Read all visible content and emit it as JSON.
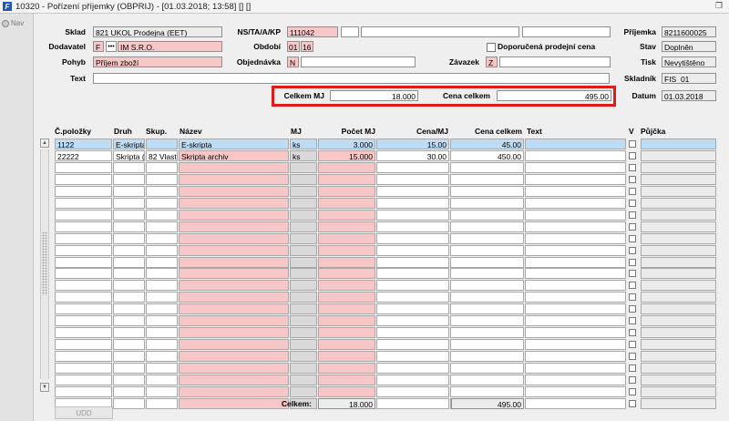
{
  "window": {
    "title": "10320 - Pořízení příjemky (OBPRIJ) - [01.03.2018; 13:58] [] []",
    "logo_text": "F"
  },
  "nav": {
    "label": "Nav"
  },
  "header": {
    "sklad": {
      "label": "Sklad",
      "value": "821 UKOL Prodejna (EET)"
    },
    "dodavatel": {
      "label": "Dodavatel",
      "code": "F",
      "dots": "•••",
      "name": "IM S.R.O."
    },
    "pohyb": {
      "label": "Pohyb",
      "value": "Příjem zboží"
    },
    "text": {
      "label": "Text",
      "value": ""
    },
    "nstaakp": {
      "label": "NS/TA/A/KP",
      "value": "111042",
      "v2": "",
      "v3": "",
      "v4": ""
    },
    "obdobi": {
      "label": "Období",
      "month": "01",
      "year": "16"
    },
    "objednavka": {
      "label": "Objednávka",
      "code": "N",
      "value": ""
    },
    "doporucena": {
      "label": "Doporučená prodejní cena",
      "checked": false
    },
    "zavazek": {
      "label": "Závazek",
      "code": "Z",
      "value": ""
    },
    "prijemka": {
      "label": "Příjemka",
      "value": "8211600025"
    },
    "stav": {
      "label": "Stav",
      "value": "Doplněn"
    },
    "tisk": {
      "label": "Tisk",
      "value": "Nevytištěno"
    },
    "skladnik": {
      "label": "Skladník",
      "value": "FIS_01"
    },
    "datum": {
      "label": "Datum",
      "value": "01.03.2018"
    },
    "celkem_mj": {
      "label": "Celkem MJ",
      "value": "18.000"
    },
    "cena_celkem": {
      "label": "Cena celkem",
      "value": "495.00"
    }
  },
  "grid": {
    "columns": {
      "polozka": "Č.položky",
      "druh": "Druh",
      "skup": "Skup.",
      "nazev": "Název",
      "mj": "MJ",
      "pocet": "Počet MJ",
      "cena_mj": "Cena/MJ",
      "cena_celkem": "Cena celkem",
      "text": "Text",
      "v": "V",
      "pujcka": "Půjčka"
    },
    "rows": [
      {
        "polozka": "1122",
        "druh": "E-skripta",
        "skup": "",
        "nazev": "E-skripta",
        "mj": "ks",
        "pocet": "3.000",
        "cena_mj": "15.00",
        "cena_celkem": "45.00",
        "text": ""
      },
      {
        "polozka": "22222",
        "druh": "Skripta (",
        "skup": "82 Vlast",
        "nazev": "Skripta archiv",
        "mj": "ks",
        "pocet": "15.000",
        "cena_mj": "30.00",
        "cena_celkem": "450.00",
        "text": ""
      }
    ],
    "empty_row_count": 21,
    "selected_row": 0
  },
  "footer": {
    "celkem_label": "Celkem:",
    "pocet_total": "18.000",
    "cena_total": "495.00",
    "udd_button": "UDD"
  },
  "colors": {
    "required_field": "#f7c6c6",
    "selected_row": "#bfdcf5",
    "highlight_box": "#e01919"
  }
}
